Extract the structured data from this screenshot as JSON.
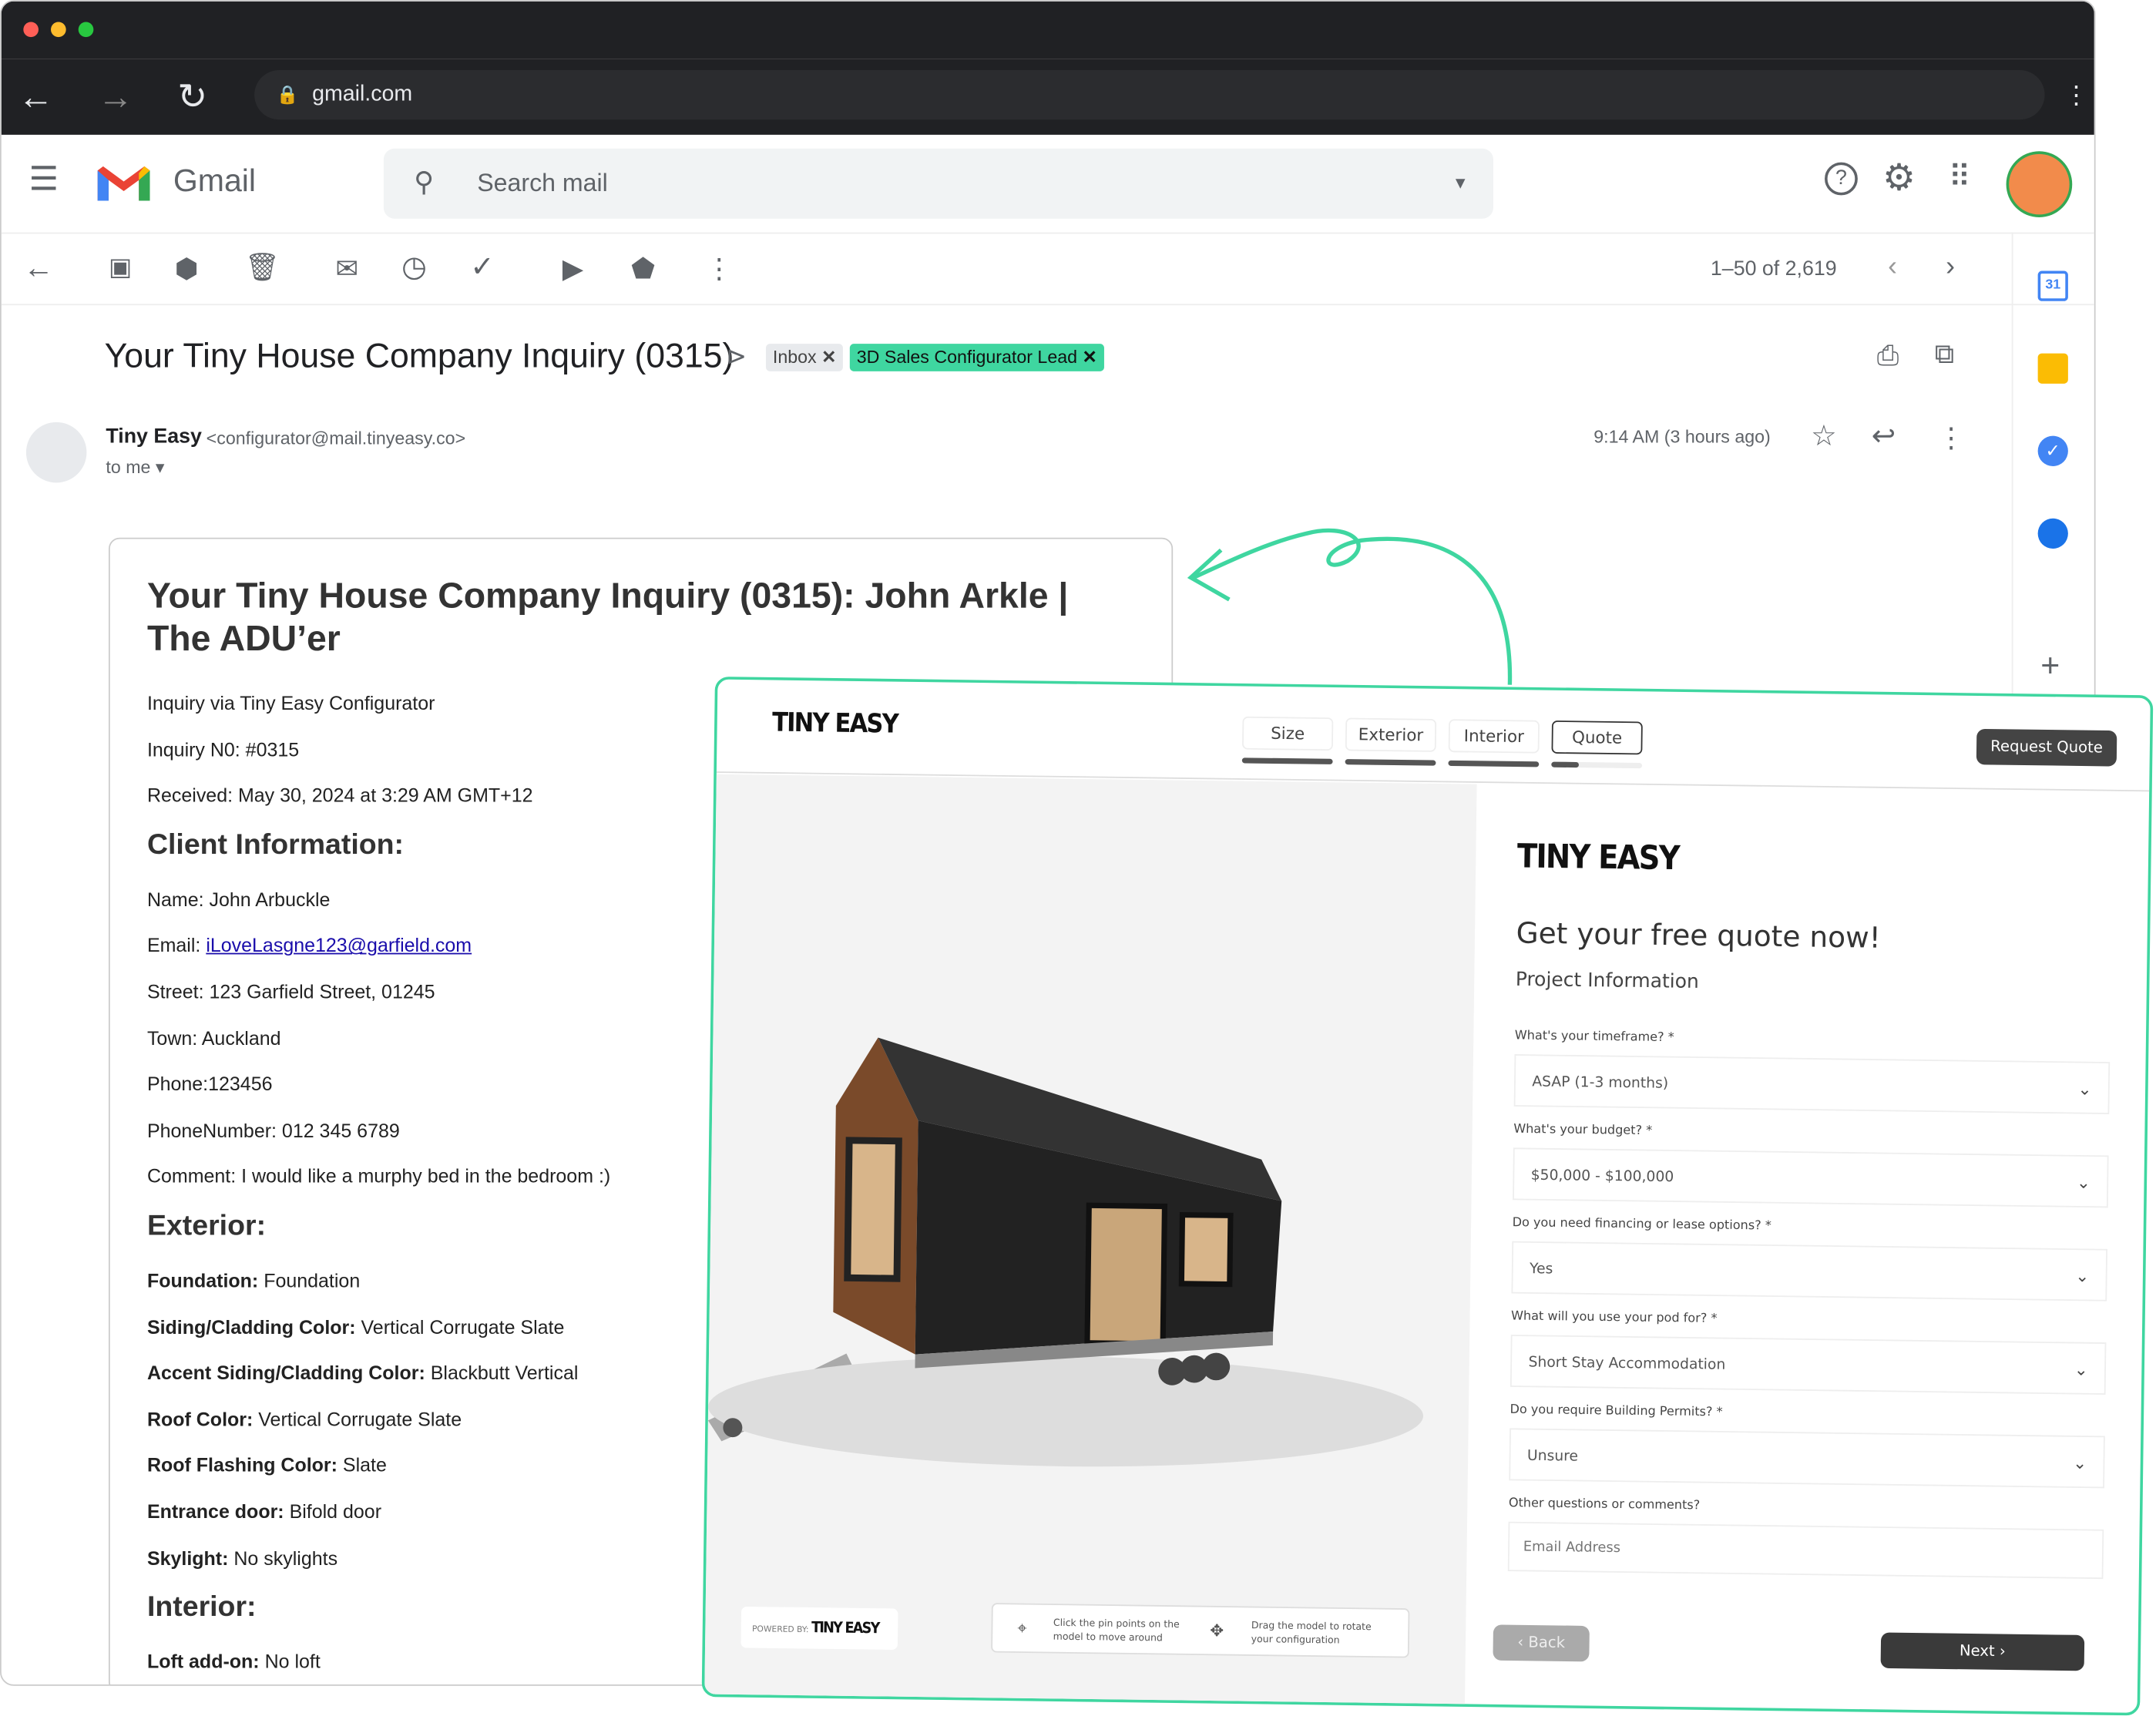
{
  "browser": {
    "url": "gmail.com"
  },
  "gmail": {
    "app_name": "Gmail",
    "search_placeholder": "Search mail",
    "pagination": "1–50 of 2,619",
    "subject": "Your Tiny House Company Inquiry (0315)",
    "labels": [
      {
        "text": "Inbox",
        "color": "#e8eaed"
      },
      {
        "text": "3D Sales Configurator Lead",
        "color": "#3fd6a0"
      }
    ],
    "sender_name": "Tiny Easy",
    "sender_email": "<configurator@mail.tinyeasy.co>",
    "to": "to me",
    "time": "9:14 AM (3 hours ago)",
    "calendar_day": "31"
  },
  "email_body": {
    "title": "Your Tiny House Company Inquiry (0315): John Arkle | The ADU’er",
    "intro": [
      "Inquiry via Tiny Easy Configurator",
      "Inquiry N0: #0315",
      "Received: May 30, 2024 at 3:29 AM GMT+12"
    ],
    "client_heading": "Client Information:",
    "name": "Name: John Arbuckle",
    "email_label": "Email: ",
    "email_link": "iLoveLasgne123@garfield.com",
    "client_lines": [
      "Street: 123 Garfield Street, 01245",
      "Town: Auckland",
      "Phone:123456",
      "PhoneNumber: 012 345 6789",
      "Comment: I would like a murphy bed in the bedroom :)"
    ],
    "exterior_heading": "Exterior:",
    "exterior": [
      {
        "k": "Foundation:",
        "v": " Foundation"
      },
      {
        "k": "Siding/Cladding Color:",
        "v": " Vertical Corrugate Slate"
      },
      {
        "k": "Accent Siding/Cladding Color:",
        "v": " Blackbutt Vertical"
      },
      {
        "k": "Roof Color:",
        "v": " Vertical Corrugate Slate"
      },
      {
        "k": "Roof Flashing Color:",
        "v": " Slate"
      },
      {
        "k": "Entrance door:",
        "v": " Bifold door"
      },
      {
        "k": "Skylight:",
        "v": " No skylights"
      }
    ],
    "interior_heading": "Interior:",
    "interior": [
      {
        "k": "Loft add-on:",
        "v": " No loft"
      }
    ]
  },
  "configurator": {
    "logo": "TINY EASY",
    "steps": [
      "Size",
      "Exterior",
      "Interior",
      "Quote"
    ],
    "step_progress": [
      1,
      1,
      1,
      0.3
    ],
    "request_quote": "Request Quote",
    "powered_by": "POWERED BY:",
    "hint1": "Click the pin points on the model to move around",
    "hint2": "Drag the model to rotate your configuration",
    "form_title": "Get your free quote now!",
    "form_subtitle": "Project Information",
    "fields": [
      {
        "label": "What's your timeframe? *",
        "value": "ASAP (1-3 months)"
      },
      {
        "label": "What's your budget? *",
        "value": "$50,000 - $100,000"
      },
      {
        "label": "Do you need financing or lease options? *",
        "value": "Yes"
      },
      {
        "label": "What will you use your pod for? *",
        "value": "Short Stay Accommodation"
      },
      {
        "label": "Do you require Building Permits? *",
        "value": "Unsure"
      }
    ],
    "comments_label": "Other questions or comments?",
    "comments_placeholder": "Email Address",
    "back": "Back",
    "next": "Next"
  }
}
